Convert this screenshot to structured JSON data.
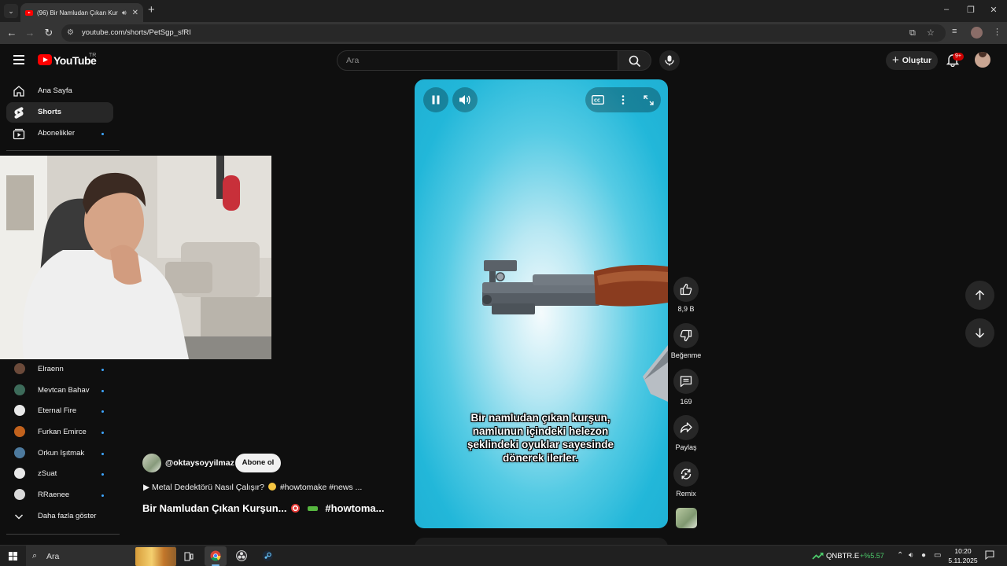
{
  "browser": {
    "tab_title": "(96) Bir Namludan Çıkan Kurşun",
    "url": "youtube.com/shorts/PetSgp_sfRI",
    "new_tab": "+",
    "window_controls": [
      "–",
      "❐",
      "✕"
    ]
  },
  "header": {
    "logo_text": "YouTube",
    "country": "TR",
    "search_placeholder": "Ara",
    "create_label": "Oluştur",
    "notifications_badge": "9+"
  },
  "sidebar": {
    "nav": [
      {
        "label": "Ana Sayfa",
        "icon": "home-icon"
      },
      {
        "label": "Shorts",
        "icon": "shorts-icon",
        "active": true
      },
      {
        "label": "Abonelikler",
        "icon": "subscriptions-icon"
      }
    ],
    "channels": [
      {
        "label": "Elraenn",
        "color": "#6b4a3a"
      },
      {
        "label": "Mevtcan Bahav",
        "color": "#3d6b5a"
      },
      {
        "label": "Eternal Fire",
        "color": "#e8e8e8"
      },
      {
        "label": "Furkan Emirce",
        "color": "#c2621d"
      },
      {
        "label": "Orkun Işıtmak",
        "color": "#4d7a9e"
      },
      {
        "label": "zSuat",
        "color": "#e8e8e8"
      },
      {
        "label": "RRaenee",
        "color": "#d9d9d9"
      }
    ],
    "show_more": "Daha fazla göster"
  },
  "video": {
    "caption_lines": [
      "Bir namludan çıkan kurşun,",
      "namlunun içindeki helezon",
      "şeklindeki oyuklar sayesinde",
      "dönerek ilerler."
    ]
  },
  "actions": {
    "likes": "8,9 B",
    "dislike": "Beğenme",
    "comments": "169",
    "share": "Paylaş",
    "remix": "Remix"
  },
  "meta": {
    "channel": "@oktaysoyyilmaz",
    "subscribe": "Abone ol",
    "related_prefix": "▶ Metal Dedektörü Nasıl Çalışır?",
    "related_tags": "#howtomake #news ...",
    "title_prefix": "Bir Namludan Çıkan Kurşun...",
    "title_suffix": "#howtoma..."
  },
  "taskbar": {
    "search_placeholder": "Ara",
    "stock_name": "QNBTR.E",
    "stock_change": "+%5.57",
    "time": "10:20",
    "date": "5.11.2025"
  },
  "colors": {
    "accent_red": "#ff0000",
    "video_bg": "#22b7d9",
    "stock_up": "#4cc96a",
    "live_dot": "#3ea6ff"
  }
}
